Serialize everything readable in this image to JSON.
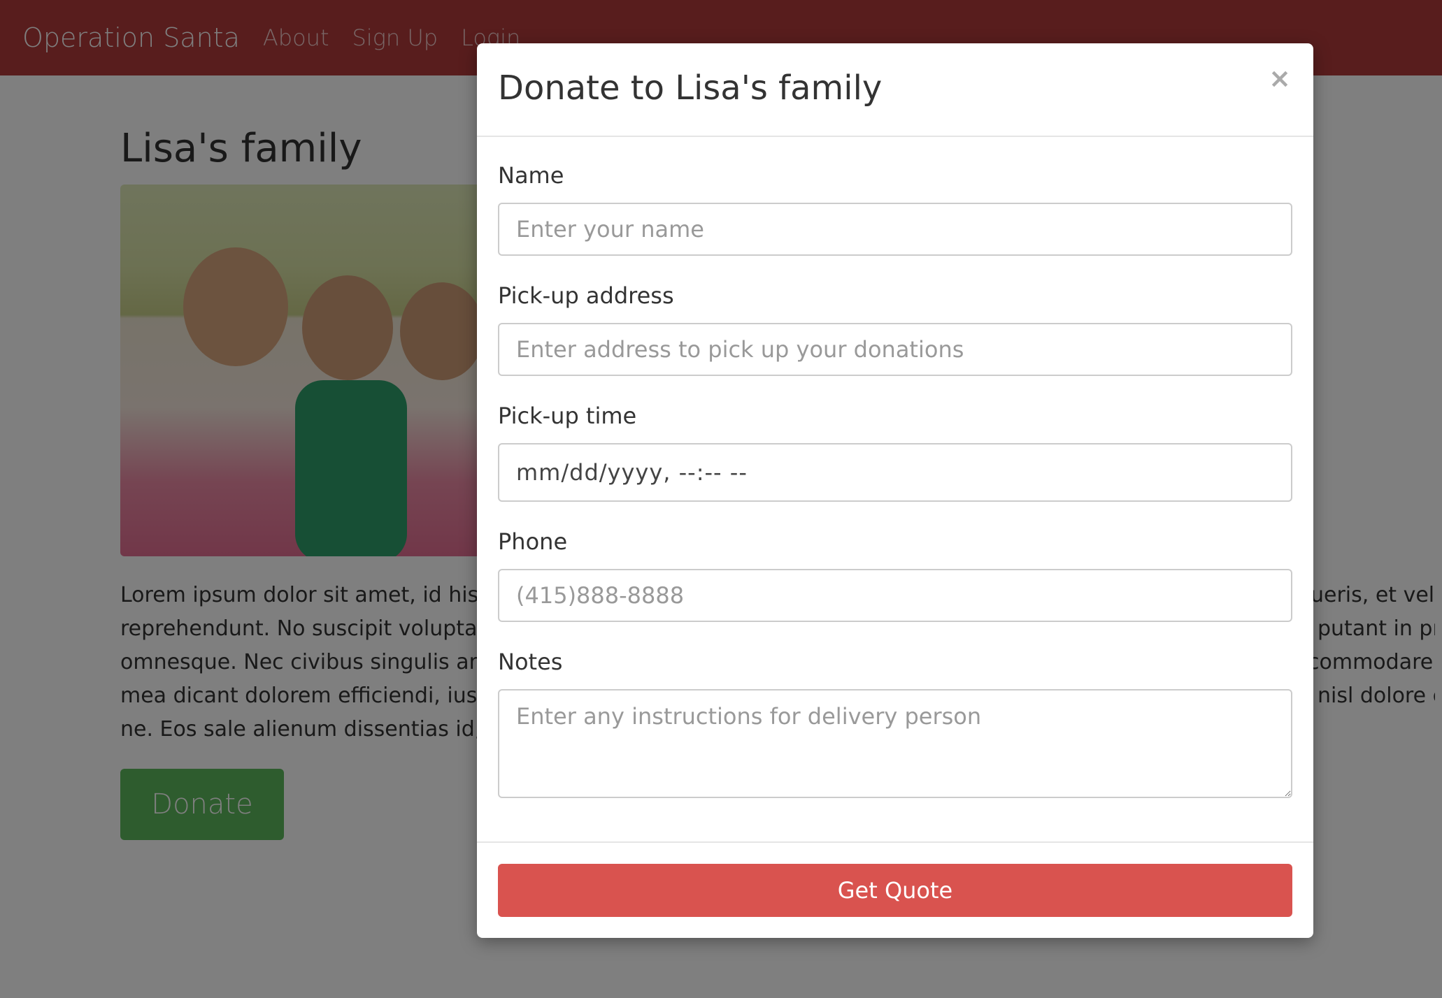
{
  "navbar": {
    "brand": "Operation Santa",
    "links": [
      "About",
      "Sign Up",
      "Login"
    ]
  },
  "page": {
    "title": "Lisa's family",
    "paragraph_lines": [
      "Lorem ipsum dolor sit amet, id his ",
      "reprehendunt. No suscipit voluptar",
      "omnesque. Nec civibus singulis an",
      "mea dicant dolorem efficiendi, ius r",
      "ne. Eos sale alienum dissentias id, a"
    ],
    "paragraph_right_lines": [
      "ueris, et vel fe",
      "putant in pri,",
      "commodare v",
      "nisl dolore c",
      ""
    ],
    "donate_label": "Donate"
  },
  "modal": {
    "title": "Donate to Lisa's family",
    "close_glyph": "×",
    "fields": {
      "name": {
        "label": "Name",
        "placeholder": "Enter your name"
      },
      "address": {
        "label": "Pick-up address",
        "placeholder": "Enter address to pick up your donations"
      },
      "time": {
        "label": "Pick-up time",
        "value": "mm/dd/yyyy, --:-- --"
      },
      "phone": {
        "label": "Phone",
        "placeholder": "(415)888-8888"
      },
      "notes": {
        "label": "Notes",
        "placeholder": "Enter any instructions for delivery person"
      }
    },
    "submit_label": "Get Quote"
  },
  "colors": {
    "navbar": "#b03a3a",
    "donate_button": "#5cb85c",
    "quote_button": "#d9534f",
    "backdrop": "rgba(0,0,0,0.5)"
  }
}
